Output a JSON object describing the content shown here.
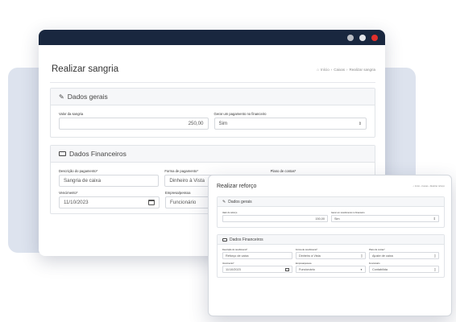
{
  "window1": {
    "title": "Realizar sangria",
    "breadcrumb": [
      "Início",
      "Caixas",
      "Realizar sangria"
    ],
    "section1": {
      "title": "Dados gerais",
      "valor_label": "Valor da sangria",
      "valor_value": "250,00",
      "gerar_label": "Gerar um pagamento no financeiro",
      "gerar_value": "Sim"
    },
    "section2": {
      "title": "Dados Financeiros",
      "descricao_label": "Descrição do pagamento*",
      "descricao_value": "Sangria de caixa",
      "forma_label": "Forma de pagamento*",
      "forma_value": "Dinheiro à Vista",
      "plano_label": "Plano de contas*",
      "vencimento_label": "Vencimento*",
      "vencimento_value": "11/10/2023",
      "empresa_label": "Empresa/pessoa",
      "empresa_value": "Funcionário"
    }
  },
  "window2": {
    "title": "Realizar reforço",
    "breadcrumb": [
      "Início",
      "Caixas",
      "Realizar reforço"
    ],
    "section1": {
      "title": "Dados gerais",
      "valor_label": "Valor do reforço",
      "valor_value": "150,00",
      "gerar_label": "Gerar um recebimento no financeiro",
      "gerar_value": "Sim"
    },
    "section2": {
      "title": "Dados Financeiros",
      "descricao_label": "Descrição do recebimento*",
      "descricao_value": "Reforço de caixa",
      "forma_label": "Forma de recebimento*",
      "forma_value": "Dinheiro à Vista",
      "plano_label": "Plano de contas*",
      "plano_value": "Ajuste de caixa",
      "vencimento_label": "Vencimento*",
      "vencimento_value": "11/10/2023",
      "empresa_label": "Empresa/pessoa",
      "empresa_value": "Funcionário",
      "funcionario_label": "Funcionário",
      "funcionario_value": "Contabilida"
    }
  },
  "colors": {
    "titlebar": "#19273f",
    "dot_gray1": "#b9bcc4",
    "dot_gray2": "#e3e5ea",
    "dot_red": "#e2302c",
    "backdrop": "#dde3ee"
  }
}
